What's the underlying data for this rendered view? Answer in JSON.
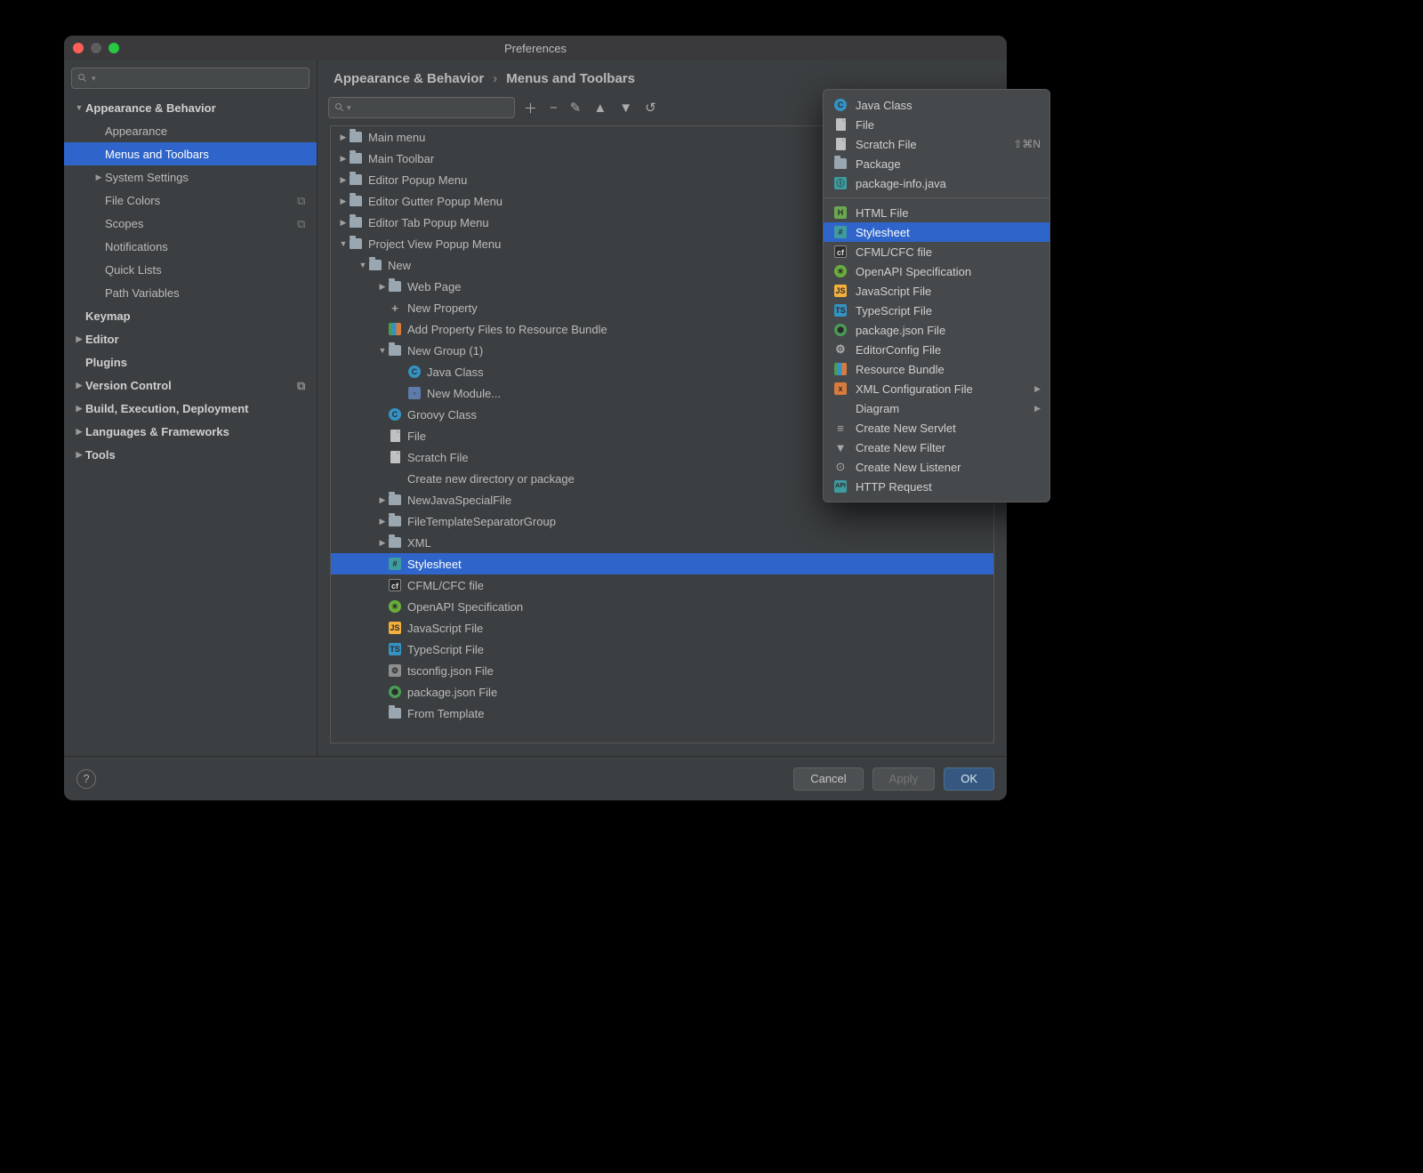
{
  "window": {
    "title": "Preferences"
  },
  "sidebar": {
    "search_placeholder": "",
    "items": [
      {
        "label": "Appearance & Behavior",
        "indent": 0,
        "bold": true,
        "arrow": "down"
      },
      {
        "label": "Appearance",
        "indent": 1
      },
      {
        "label": "Menus and Toolbars",
        "indent": 1,
        "selected": true
      },
      {
        "label": "System Settings",
        "indent": 1,
        "arrow": "right"
      },
      {
        "label": "File Colors",
        "indent": 1,
        "config": true
      },
      {
        "label": "Scopes",
        "indent": 1,
        "config": true
      },
      {
        "label": "Notifications",
        "indent": 1
      },
      {
        "label": "Quick Lists",
        "indent": 1
      },
      {
        "label": "Path Variables",
        "indent": 1
      },
      {
        "label": "Keymap",
        "indent": 0,
        "bold": true
      },
      {
        "label": "Editor",
        "indent": 0,
        "bold": true,
        "arrow": "right"
      },
      {
        "label": "Plugins",
        "indent": 0,
        "bold": true
      },
      {
        "label": "Version Control",
        "indent": 0,
        "bold": true,
        "arrow": "right",
        "config": true
      },
      {
        "label": "Build, Execution, Deployment",
        "indent": 0,
        "bold": true,
        "arrow": "right"
      },
      {
        "label": "Languages & Frameworks",
        "indent": 0,
        "bold": true,
        "arrow": "right"
      },
      {
        "label": "Tools",
        "indent": 0,
        "bold": true,
        "arrow": "right"
      }
    ]
  },
  "breadcrumb": {
    "a": "Appearance & Behavior",
    "b": "Menus and Toolbars"
  },
  "main_tree": [
    {
      "label": "Main menu",
      "indent": 0,
      "arrow": "right",
      "icon": "folder"
    },
    {
      "label": "Main Toolbar",
      "indent": 0,
      "arrow": "right",
      "icon": "folder"
    },
    {
      "label": "Editor Popup Menu",
      "indent": 0,
      "arrow": "right",
      "icon": "folder"
    },
    {
      "label": "Editor Gutter Popup Menu",
      "indent": 0,
      "arrow": "right",
      "icon": "folder"
    },
    {
      "label": "Editor Tab Popup Menu",
      "indent": 0,
      "arrow": "right",
      "icon": "folder"
    },
    {
      "label": "Project View Popup Menu",
      "indent": 0,
      "arrow": "down",
      "icon": "folder"
    },
    {
      "label": "New",
      "indent": 1,
      "arrow": "down",
      "icon": "folder"
    },
    {
      "label": "Web Page",
      "indent": 2,
      "arrow": "right",
      "icon": "folder"
    },
    {
      "label": "New Property",
      "indent": 2,
      "icon": "plus"
    },
    {
      "label": "Add Property Files to Resource Bundle",
      "indent": 2,
      "icon": "bars"
    },
    {
      "label": "New Group (1)",
      "indent": 2,
      "arrow": "down",
      "icon": "folder"
    },
    {
      "label": "Java Class",
      "indent": 3,
      "icon": "blue-c"
    },
    {
      "label": "New Module...",
      "indent": 3,
      "icon": "module"
    },
    {
      "label": "Groovy Class",
      "indent": 2,
      "icon": "blue-c"
    },
    {
      "label": "File",
      "indent": 2,
      "icon": "file"
    },
    {
      "label": "Scratch File",
      "indent": 2,
      "icon": "file"
    },
    {
      "label": "Create new directory or package",
      "indent": 2,
      "icon": "none"
    },
    {
      "label": "NewJavaSpecialFile",
      "indent": 2,
      "arrow": "right",
      "icon": "folder"
    },
    {
      "label": "FileTemplateSeparatorGroup",
      "indent": 2,
      "arrow": "right",
      "icon": "folder"
    },
    {
      "label": "XML",
      "indent": 2,
      "arrow": "right",
      "icon": "folder"
    },
    {
      "label": "Stylesheet",
      "indent": 2,
      "icon": "css",
      "selected": true
    },
    {
      "label": "CFML/CFC file",
      "indent": 2,
      "icon": "cf"
    },
    {
      "label": "OpenAPI Specification",
      "indent": 2,
      "icon": "openapi"
    },
    {
      "label": "JavaScript File",
      "indent": 2,
      "icon": "js"
    },
    {
      "label": "TypeScript File",
      "indent": 2,
      "icon": "ts"
    },
    {
      "label": "tsconfig.json File",
      "indent": 2,
      "icon": "tsconf"
    },
    {
      "label": "package.json File",
      "indent": 2,
      "icon": "node"
    },
    {
      "label": "From Template",
      "indent": 2,
      "icon": "folder"
    }
  ],
  "footer": {
    "cancel": "Cancel",
    "apply": "Apply",
    "ok": "OK"
  },
  "popup": [
    {
      "label": "Java Class",
      "icon": "blue-c"
    },
    {
      "label": "File",
      "icon": "file"
    },
    {
      "label": "Scratch File",
      "icon": "file",
      "shortcut": "⇧⌘N"
    },
    {
      "label": "Package",
      "icon": "folder"
    },
    {
      "label": "package-info.java",
      "icon": "pkginfo"
    },
    {
      "sep": true
    },
    {
      "label": "HTML File",
      "icon": "html"
    },
    {
      "label": "Stylesheet",
      "icon": "css",
      "selected": true
    },
    {
      "label": "CFML/CFC file",
      "icon": "cf"
    },
    {
      "label": "OpenAPI Specification",
      "icon": "openapi"
    },
    {
      "label": "JavaScript File",
      "icon": "js"
    },
    {
      "label": "TypeScript File",
      "icon": "ts"
    },
    {
      "label": "package.json File",
      "icon": "node"
    },
    {
      "label": "EditorConfig File",
      "icon": "gear"
    },
    {
      "label": "Resource Bundle",
      "icon": "bars"
    },
    {
      "label": "XML Configuration File",
      "icon": "xml",
      "sub": true
    },
    {
      "label": "Diagram",
      "icon": "none",
      "sub": true
    },
    {
      "label": "Create New Servlet",
      "icon": "servlet"
    },
    {
      "label": "Create New Filter",
      "icon": "filter"
    },
    {
      "label": "Create New Listener",
      "icon": "listener"
    },
    {
      "label": "HTTP Request",
      "icon": "http"
    }
  ]
}
